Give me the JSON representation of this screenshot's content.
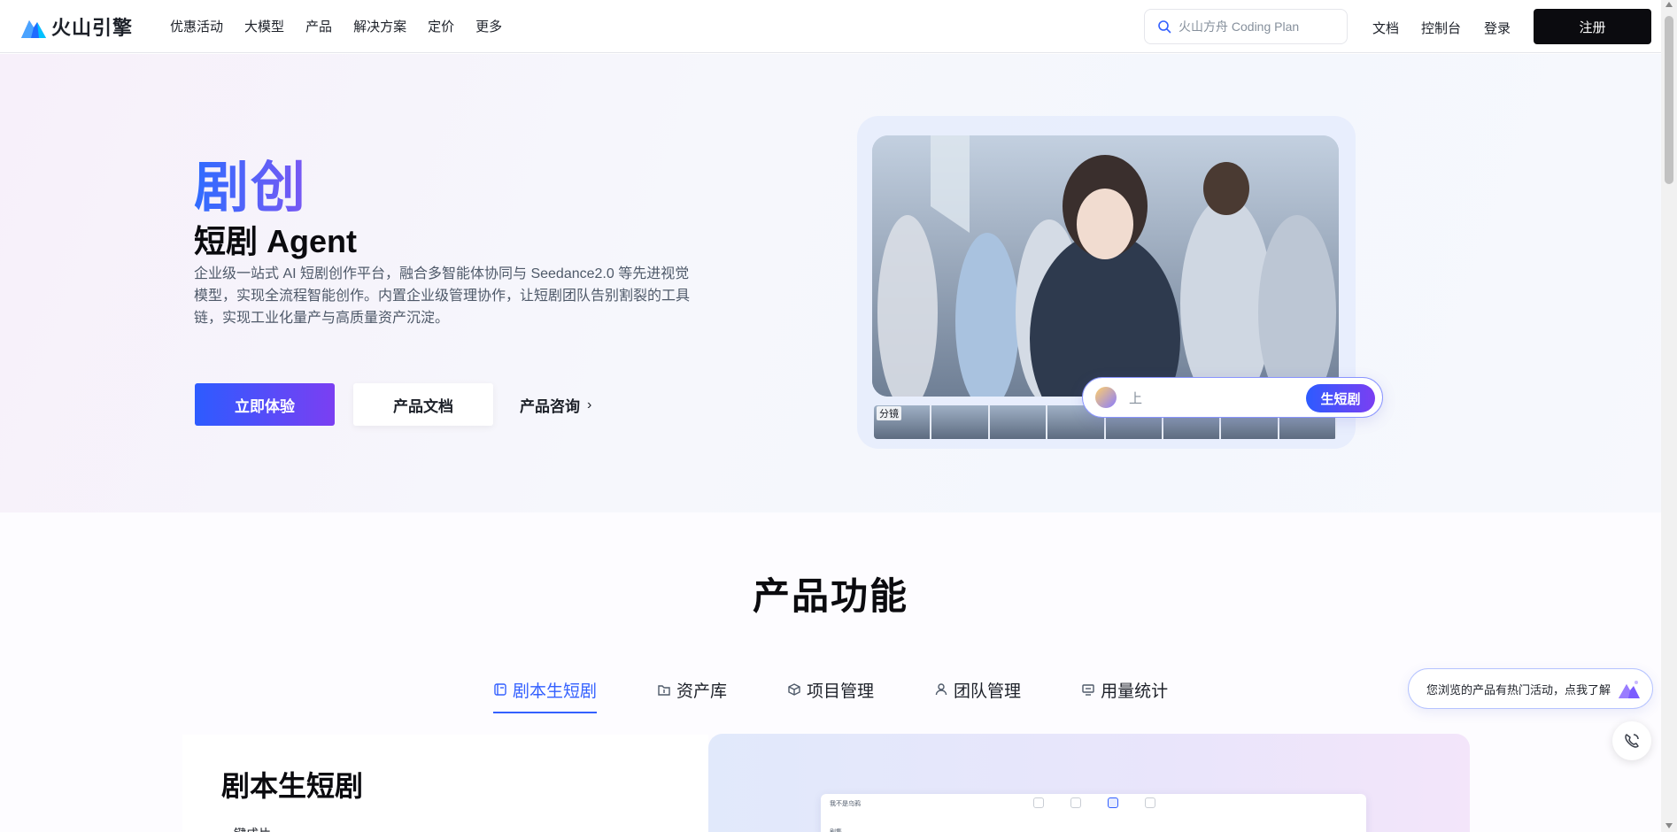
{
  "brand": {
    "name": "火山引擎"
  },
  "nav": {
    "items": [
      "优惠活动",
      "大模型",
      "产品",
      "解决方案",
      "定价",
      "更多"
    ],
    "search_placeholder": "火山方舟 Coding Plan",
    "docs": "文档",
    "console": "控制台",
    "login": "登录",
    "register": "注册"
  },
  "hero": {
    "title": "剧创",
    "subtitle": "短剧 Agent",
    "description": "企业级一站式 AI 短剧创作平台，融合多智能体协同与 Seedance2.0 等先进视觉模型，实现全流程智能创作。内置企业级管理协作，让短剧团队告别割裂的工具链，实现工业化量产与高质量资产沉淀。",
    "primary_button": "立即体验",
    "secondary_button": "产品文档",
    "consult_link": "产品咨询",
    "thumbs_label": "分镜",
    "prompt_text": "上",
    "prompt_button": "生短剧"
  },
  "features": {
    "title": "产品功能",
    "tabs": [
      {
        "label": "剧本生短剧",
        "icon": "script-icon",
        "active": true
      },
      {
        "label": "资产库",
        "icon": "folder-icon",
        "active": false
      },
      {
        "label": "项目管理",
        "icon": "cube-icon",
        "active": false
      },
      {
        "label": "团队管理",
        "icon": "user-icon",
        "active": false
      },
      {
        "label": "用量统计",
        "icon": "monitor-icon",
        "active": false
      }
    ],
    "card_title": "剧本生短剧",
    "card_sub": "一键成片",
    "mini_title": "我不是乌鸦",
    "mini_label": "剧集"
  },
  "floating": {
    "promo": "您浏览的产品有热门活动，点我了解"
  },
  "colors": {
    "accent": "#3360ff",
    "gradient_start": "#2d5bff",
    "gradient_end": "#7b3ff2",
    "register_bg": "#0b0b0f"
  }
}
